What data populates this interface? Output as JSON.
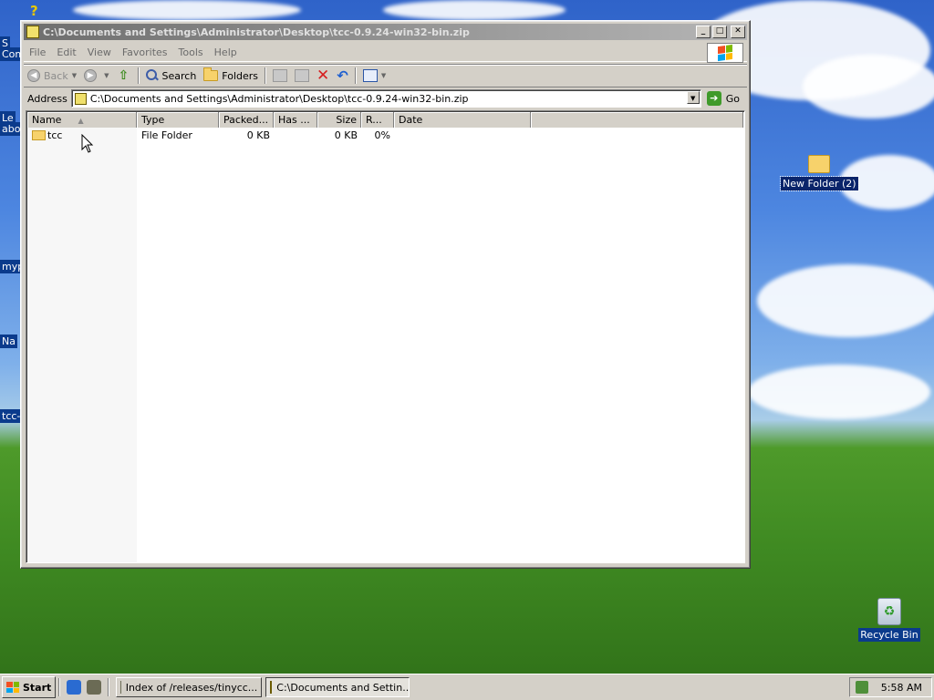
{
  "desktop": {
    "new_folder_label": "New Folder (2)",
    "recycle_bin_label": "Recycle Bin",
    "partial_labels": [
      "S",
      "Com",
      "Le",
      "abo",
      "myp",
      "Na",
      "tcc-"
    ]
  },
  "window": {
    "title": "C:\\Documents and Settings\\Administrator\\Desktop\\tcc-0.9.24-win32-bin.zip",
    "controls": {
      "minimize": "_",
      "maximize": "□",
      "close": "✕"
    }
  },
  "menu": [
    "File",
    "Edit",
    "View",
    "Favorites",
    "Tools",
    "Help"
  ],
  "toolbar": {
    "back": "Back",
    "search": "Search",
    "folders": "Folders"
  },
  "address": {
    "label": "Address",
    "value": "C:\\Documents and Settings\\Administrator\\Desktop\\tcc-0.9.24-win32-bin.zip",
    "go": "Go"
  },
  "list": {
    "columns": [
      "Name",
      "Type",
      "Packed...",
      "Has ...",
      "Size",
      "R...",
      "Date"
    ],
    "rows": [
      {
        "name": "tcc",
        "type": "File Folder",
        "packed": "0 KB",
        "has": "",
        "size": "0 KB",
        "ratio": "0%",
        "date": ""
      }
    ]
  },
  "taskbar": {
    "start": "Start",
    "tasks": [
      {
        "label": "Index of /releases/tinycc..."
      },
      {
        "label": "C:\\Documents and Settin..."
      }
    ],
    "clock": "5:58 AM"
  }
}
